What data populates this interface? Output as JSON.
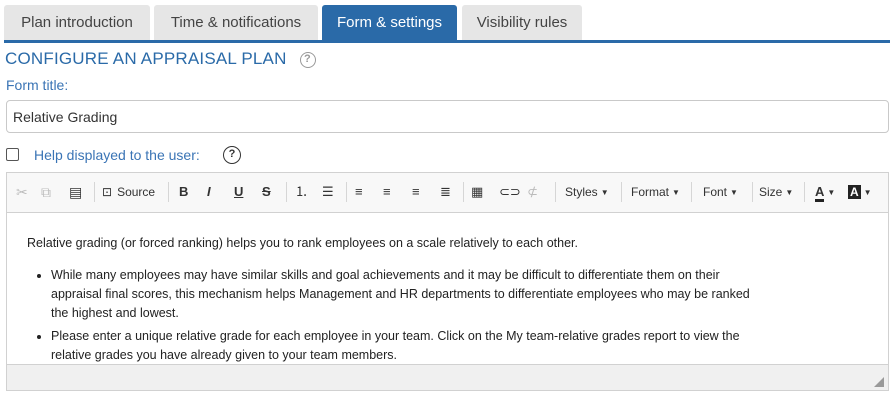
{
  "tabs": [
    {
      "label": "Plan introduction",
      "active": false
    },
    {
      "label": "Time & notifications",
      "active": false
    },
    {
      "label": "Form & settings",
      "active": true
    },
    {
      "label": "Visibility rules",
      "active": false
    }
  ],
  "colors": {
    "accent": "#2a6aa8",
    "label": "#3a74b5",
    "tab_inactive": "#e6e6e6"
  },
  "page_title": "CONFIGURE AN APPRAISAL PLAN",
  "form": {
    "title_label": "Form title:",
    "title_value": "Relative Grading",
    "help_label": "Help displayed to the user:",
    "help_checked": false
  },
  "toolbar": {
    "source": "Source",
    "styles": "Styles",
    "format": "Format",
    "font": "Font",
    "size": "Size"
  },
  "content": {
    "paragraph": "Relative grading (or forced ranking) helps you to rank employees on a scale relatively to each other.",
    "bullets": [
      "While many employees may have similar skills and goal achievements and it may be difficult to differentiate them on their appraisal final scores, this mechanism helps Management and HR departments to differentiate employees who may be ranked the highest and lowest.",
      "Please enter a unique relative grade for each employee in your team. Click on the My team-relative grades report to view the relative grades you have already given to your team members."
    ]
  },
  "icons": [
    "cut-icon",
    "copy-icon",
    "paste-text-icon",
    "source-icon",
    "bold-icon",
    "italic-icon",
    "underline-icon",
    "strikethrough-icon",
    "numbered-list-icon",
    "bulleted-list-icon",
    "align-left-icon",
    "align-center-icon",
    "align-right-icon",
    "justify-icon",
    "table-icon",
    "link-icon",
    "unlink-icon",
    "text-color-icon",
    "background-color-icon",
    "help-icon",
    "resize-grip-icon"
  ]
}
